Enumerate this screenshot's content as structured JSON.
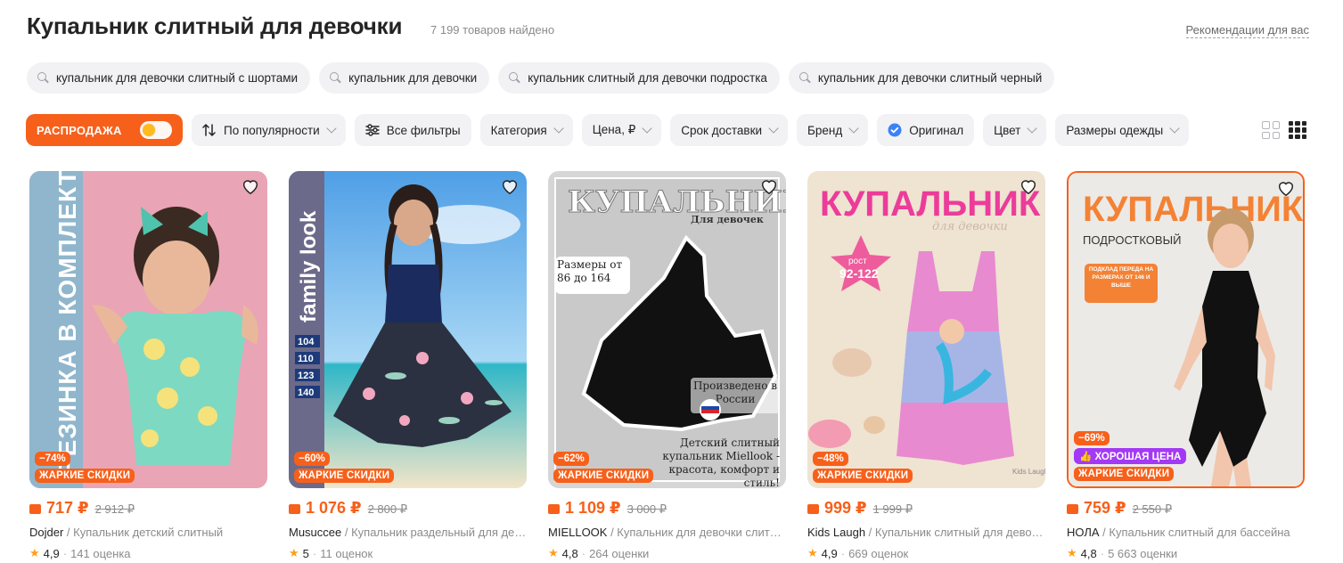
{
  "header": {
    "title": "Купальник слитный для девочки",
    "found": "7 199 товаров найдено",
    "recommendations": "Рекомендации для вас"
  },
  "suggestions": [
    "купальник для девочки слитный с шортами",
    "купальник для девочки",
    "купальник слитный для девочки подростка",
    "купальник для девочки слитный черный"
  ],
  "filters": {
    "sale_label": "РАСПРОДАЖА",
    "sort": "По популярности",
    "all_filters": "Все фильтры",
    "category": "Категория",
    "price": "Цена, ₽",
    "delivery": "Срок доставки",
    "brand": "Бренд",
    "original": "Оригинал",
    "color": "Цвет",
    "sizes": "Размеры одежды"
  },
  "colors": {
    "accent": "#f7601a",
    "price": "#f7601a",
    "good_price_badge": "#a339f4",
    "star": "#ff9e1b",
    "chip_bg": "#f2f2f5"
  },
  "products": [
    {
      "discount": "−74%",
      "hot": "ЖАРКИЕ СКИДКИ",
      "price": "717 ₽",
      "old_price": "2 912 ₽",
      "brand": "Dojder",
      "title": " / Купальник детский слитный",
      "rating": "4,9",
      "reviews": "141 оценка",
      "photo_text": "РЕЗИНКА В КОМПЛЕКТЕ"
    },
    {
      "discount": "−60%",
      "hot": "ЖАРКИЕ СКИДКИ",
      "price": "1 076 ₽",
      "old_price": "2 800 ₽",
      "brand": "Musuccee",
      "title": " / Купальник раздельный для девочки",
      "rating": "5",
      "reviews": "11 оценок",
      "photo_text": "family look",
      "sizes": [
        "104",
        "110",
        "123",
        "140"
      ]
    },
    {
      "discount": "−62%",
      "hot": "ЖАРКИЕ СКИДКИ",
      "price": "1 109 ₽",
      "old_price": "3 000 ₽",
      "brand": "MIELLOOK",
      "title": " / Купальник для девочки слитный",
      "rating": "4,8",
      "reviews": "264 оценки",
      "photo_title": "КУПАЛЬНИК",
      "photo_sub": "Для девочек",
      "photo_sizes": "Размеры от 86 до 164",
      "photo_made": "Произведено в России",
      "photo_desc": "Детский слитный купальник Miellook - красота, комфорт и стиль!"
    },
    {
      "discount": "−48%",
      "hot": "ЖАРКИЕ СКИДКИ",
      "price": "999 ₽",
      "old_price": "1 999 ₽",
      "brand": "Kids Laugh",
      "title": " / Купальник слитный для девочки",
      "rating": "4,9",
      "reviews": "669 оценок",
      "photo_title": "КУПАЛЬНИК",
      "photo_sub": "для девочки",
      "photo_rost": "рост",
      "photo_range": "92-122",
      "photo_logo": "Kids Laugh"
    },
    {
      "discount": "−69%",
      "good_price": "ХОРОШАЯ ЦЕНА",
      "hot": "ЖАРКИЕ СКИДКИ",
      "price": "759 ₽",
      "old_price": "2 550 ₽",
      "brand": "НОЛА",
      "title": " / Купальник слитный для бассейна",
      "rating": "4,8",
      "reviews": "5 663 оценки",
      "photo_title": "КУПАЛЬНИК",
      "photo_sub": "ПОДРОСТКОВЫЙ",
      "photo_note": "ПОДКЛАД ПЕРЕДА НА РАЗМЕРАХ ОТ 146 И ВЫШЕ"
    }
  ]
}
